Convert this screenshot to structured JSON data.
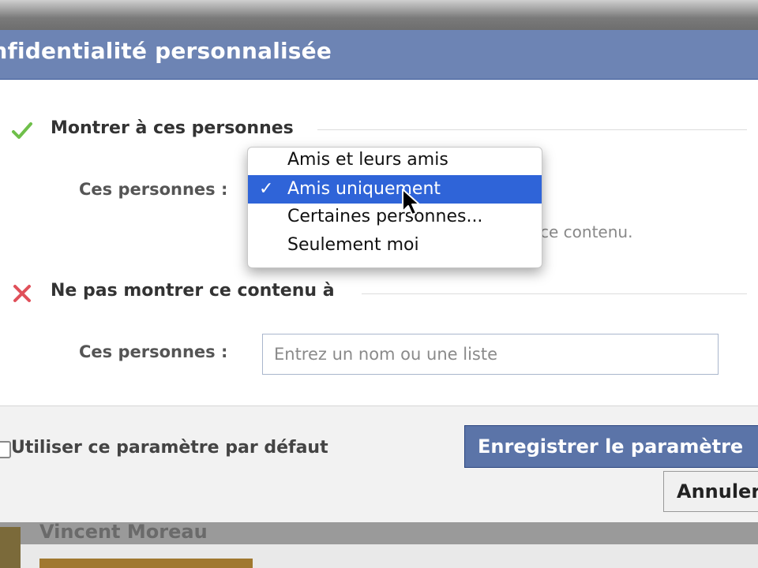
{
  "dialog": {
    "title": "onfidentialité personnalisée"
  },
  "show_section": {
    "heading": "Montrer à ces personnes",
    "icon": "check-icon",
    "field_label": "Ces personnes :",
    "hint_text": "ce contenu."
  },
  "dropdown": {
    "options": [
      {
        "label": "Amis et leurs amis",
        "selected": false
      },
      {
        "label": "Amis uniquement",
        "selected": true
      },
      {
        "label": "Certaines personnes...",
        "selected": false
      },
      {
        "label": "Seulement moi",
        "selected": false
      }
    ],
    "checkmark": "✓"
  },
  "hide_section": {
    "heading": "Ne pas montrer ce contenu à",
    "icon": "x-icon",
    "field_label": "Ces personnes :",
    "input_placeholder": "Entrez un nom ou une liste",
    "input_value": ""
  },
  "footer": {
    "default_checkbox_label": "Utiliser ce paramètre par défaut",
    "default_checked": false,
    "save_label": "Enregistrer le paramètre",
    "cancel_label": "Annuler"
  },
  "background": {
    "name": "Vincent Moreau"
  },
  "colors": {
    "header_blue": "#6d84b4",
    "selection_blue": "#2f64d8",
    "check_green": "#6fbf4a",
    "x_red": "#e0505a"
  }
}
